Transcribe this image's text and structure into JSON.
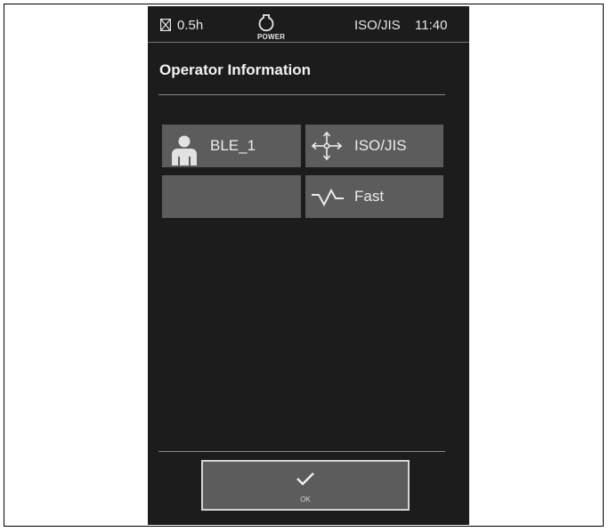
{
  "status_bar": {
    "hours": "0.5h",
    "power_label": "POWER",
    "mode": "ISO/JIS",
    "time": "11:40"
  },
  "page": {
    "title": "Operator Information"
  },
  "tiles": {
    "operator": {
      "label": "BLE_1",
      "icon": "person-icon"
    },
    "pattern": {
      "label": "ISO/JIS",
      "icon": "four-way-arrows-icon"
    },
    "empty": {
      "label": ""
    },
    "response": {
      "label": "Fast",
      "icon": "signal-wave-icon"
    }
  },
  "footer": {
    "ok_label": "OK"
  },
  "colors": {
    "screen_bg": "#1c1c1c",
    "tile_bg": "#5c5c5c",
    "text": "#ececec"
  }
}
